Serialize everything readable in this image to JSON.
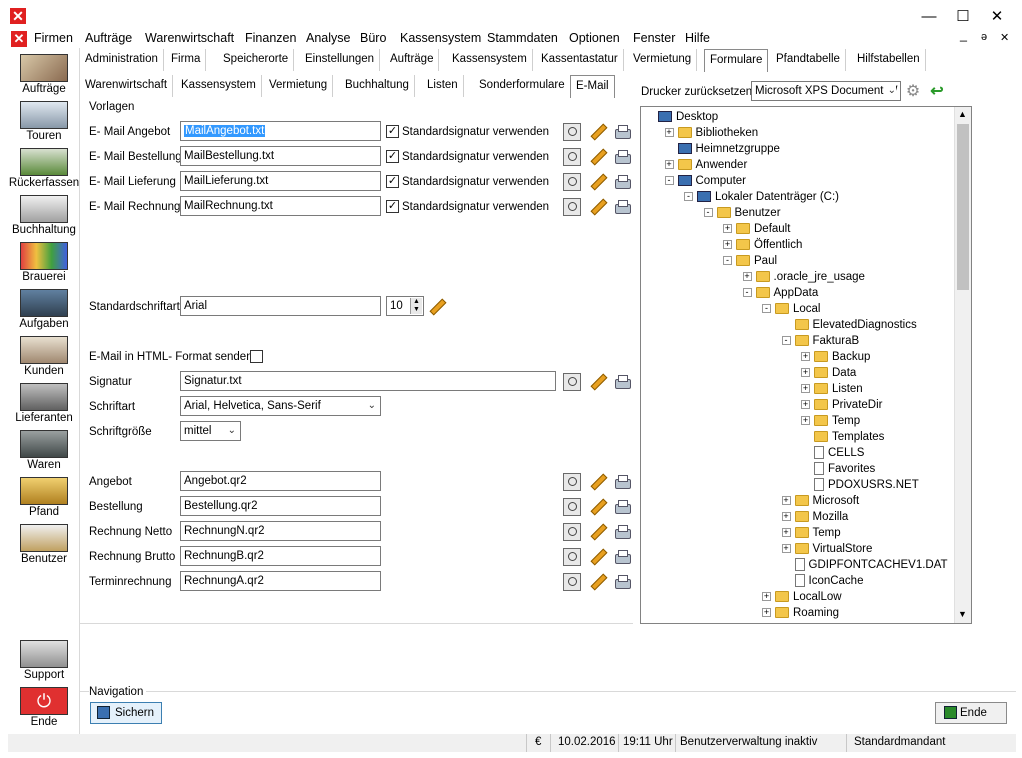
{
  "window": {
    "app_icon": "x-logo-icon",
    "minimize": "—",
    "maximize": "☐",
    "close": "✕"
  },
  "menu": {
    "items": [
      "Firmen",
      "Aufträge",
      "Warenwirtschaft",
      "Finanzen",
      "Analyse",
      "Büro",
      "Kassensystem",
      "Stammdaten",
      "Optionen",
      "Fenster",
      "Hilfe"
    ],
    "mdi_minimize": "_",
    "mdi_restore": "ə",
    "mdi_close": "✕"
  },
  "sidebar": {
    "items": [
      "Aufträge",
      "Touren",
      "Rückerfassen",
      "Buchhaltung",
      "Brauerei",
      "Aufgaben",
      "Kunden",
      "Lieferanten",
      "Waren",
      "Pfand",
      "Benutzer"
    ],
    "support": "Support",
    "ende": "Ende"
  },
  "tabs_top": [
    "Administration",
    "Firma",
    "Speicherorte",
    "Einstellungen",
    "Aufträge",
    "Kassensystem",
    "Kassentastatur",
    "Vermietung",
    "Formulare",
    "Pfandtabelle",
    "Hilfstabellen"
  ],
  "tabs_sub": [
    "Warenwirtschaft",
    "Kassensystem",
    "Vermietung",
    "Buchhaltung",
    "Listen",
    "Sonderformulare",
    "E-Mail"
  ],
  "form": {
    "vorlagen": "Vorlagen",
    "rows": [
      {
        "label": "E- Mail Angebot",
        "value": "MailAngebot.txt",
        "check_label": "Standardsignatur verwenden"
      },
      {
        "label": "E- Mail Bestellung",
        "value": "MailBestellung.txt",
        "check_label": "Standardsignatur verwenden"
      },
      {
        "label": "E- Mail Lieferung",
        "value": "MailLieferung.txt",
        "check_label": "Standardsignatur verwenden"
      },
      {
        "label": "E- Mail Rechnung",
        "value": "MailRechnung.txt",
        "check_label": "Standardsignatur verwenden"
      }
    ],
    "std_font_label": "Standardschriftart",
    "std_font_value": "Arial",
    "std_font_size": "10",
    "html_label": "E-Mail in HTML- Format senden",
    "signatur_label": "Signatur",
    "signatur_value": "Signatur.txt",
    "schriftart_label": "Schriftart",
    "schriftart_value": "Arial, Helvetica, Sans-Serif",
    "schriftgroesse_label": "Schriftgröße",
    "schriftgroesse_value": "mittel",
    "reports": [
      {
        "label": "Angebot",
        "value": "Angebot.qr2"
      },
      {
        "label": "Bestellung",
        "value": "Bestellung.qr2"
      },
      {
        "label": "Rechnung Netto",
        "value": "RechnungN.qr2"
      },
      {
        "label": "Rechnung Brutto",
        "value": "RechnungB.qr2"
      },
      {
        "label": "Terminrechnung",
        "value": "RechnungA.qr2"
      }
    ],
    "navigation_label": "Navigation",
    "sichern": "Sichern",
    "ende": "Ende"
  },
  "printer": {
    "label": "Drucker zurücksetzen:",
    "value": "Microsoft XPS Document W"
  },
  "tree": [
    {
      "label": "Desktop",
      "indent": 0,
      "ex": "",
      "icon": "comp"
    },
    {
      "label": "Bibliotheken",
      "indent": 1,
      "ex": "+",
      "icon": "fold"
    },
    {
      "label": "Heimnetzgruppe",
      "indent": 1,
      "ex": "",
      "icon": "comp"
    },
    {
      "label": "Anwender",
      "indent": 1,
      "ex": "+",
      "icon": "fold"
    },
    {
      "label": "Computer",
      "indent": 1,
      "ex": "-",
      "icon": "comp"
    },
    {
      "label": "Lokaler Datenträger (C:)",
      "indent": 2,
      "ex": "-",
      "icon": "comp"
    },
    {
      "label": "Benutzer",
      "indent": 3,
      "ex": "-",
      "icon": "fold"
    },
    {
      "label": "Default",
      "indent": 4,
      "ex": "+",
      "icon": "fold"
    },
    {
      "label": "Öffentlich",
      "indent": 4,
      "ex": "+",
      "icon": "fold"
    },
    {
      "label": "Paul",
      "indent": 4,
      "ex": "-",
      "icon": "fold"
    },
    {
      "label": ".oracle_jre_usage",
      "indent": 5,
      "ex": "+",
      "icon": "fold"
    },
    {
      "label": "AppData",
      "indent": 5,
      "ex": "-",
      "icon": "fold"
    },
    {
      "label": "Local",
      "indent": 6,
      "ex": "-",
      "icon": "fold"
    },
    {
      "label": "ElevatedDiagnostics",
      "indent": 7,
      "ex": "",
      "icon": "fold"
    },
    {
      "label": "FakturaB",
      "indent": 7,
      "ex": "-",
      "icon": "fold"
    },
    {
      "label": "Backup",
      "indent": 8,
      "ex": "+",
      "icon": "fold"
    },
    {
      "label": "Data",
      "indent": 8,
      "ex": "+",
      "icon": "fold"
    },
    {
      "label": "Listen",
      "indent": 8,
      "ex": "+",
      "icon": "fold"
    },
    {
      "label": "PrivateDir",
      "indent": 8,
      "ex": "+",
      "icon": "fold"
    },
    {
      "label": "Temp",
      "indent": 8,
      "ex": "+",
      "icon": "fold"
    },
    {
      "label": "Templates",
      "indent": 8,
      "ex": "",
      "icon": "fold"
    },
    {
      "label": "CELLS",
      "indent": 8,
      "ex": "",
      "icon": "file"
    },
    {
      "label": "Favorites",
      "indent": 8,
      "ex": "",
      "icon": "file"
    },
    {
      "label": "PDOXUSRS.NET",
      "indent": 8,
      "ex": "",
      "icon": "file"
    },
    {
      "label": "Microsoft",
      "indent": 7,
      "ex": "+",
      "icon": "fold"
    },
    {
      "label": "Mozilla",
      "indent": 7,
      "ex": "+",
      "icon": "fold"
    },
    {
      "label": "Temp",
      "indent": 7,
      "ex": "+",
      "icon": "fold"
    },
    {
      "label": "VirtualStore",
      "indent": 7,
      "ex": "+",
      "icon": "fold"
    },
    {
      "label": "GDIPFONTCACHEV1.DAT",
      "indent": 7,
      "ex": "",
      "icon": "file"
    },
    {
      "label": "IconCache",
      "indent": 7,
      "ex": "",
      "icon": "file"
    },
    {
      "label": "LocalLow",
      "indent": 6,
      "ex": "+",
      "icon": "fold"
    },
    {
      "label": "Roaming",
      "indent": 6,
      "ex": "+",
      "icon": "fold"
    }
  ],
  "status": {
    "currency": "€",
    "date": "10.02.2016",
    "time": "19:11 Uhr",
    "info": "Benutzerverwaltung inaktiv",
    "mandant": "Standardmandant"
  }
}
